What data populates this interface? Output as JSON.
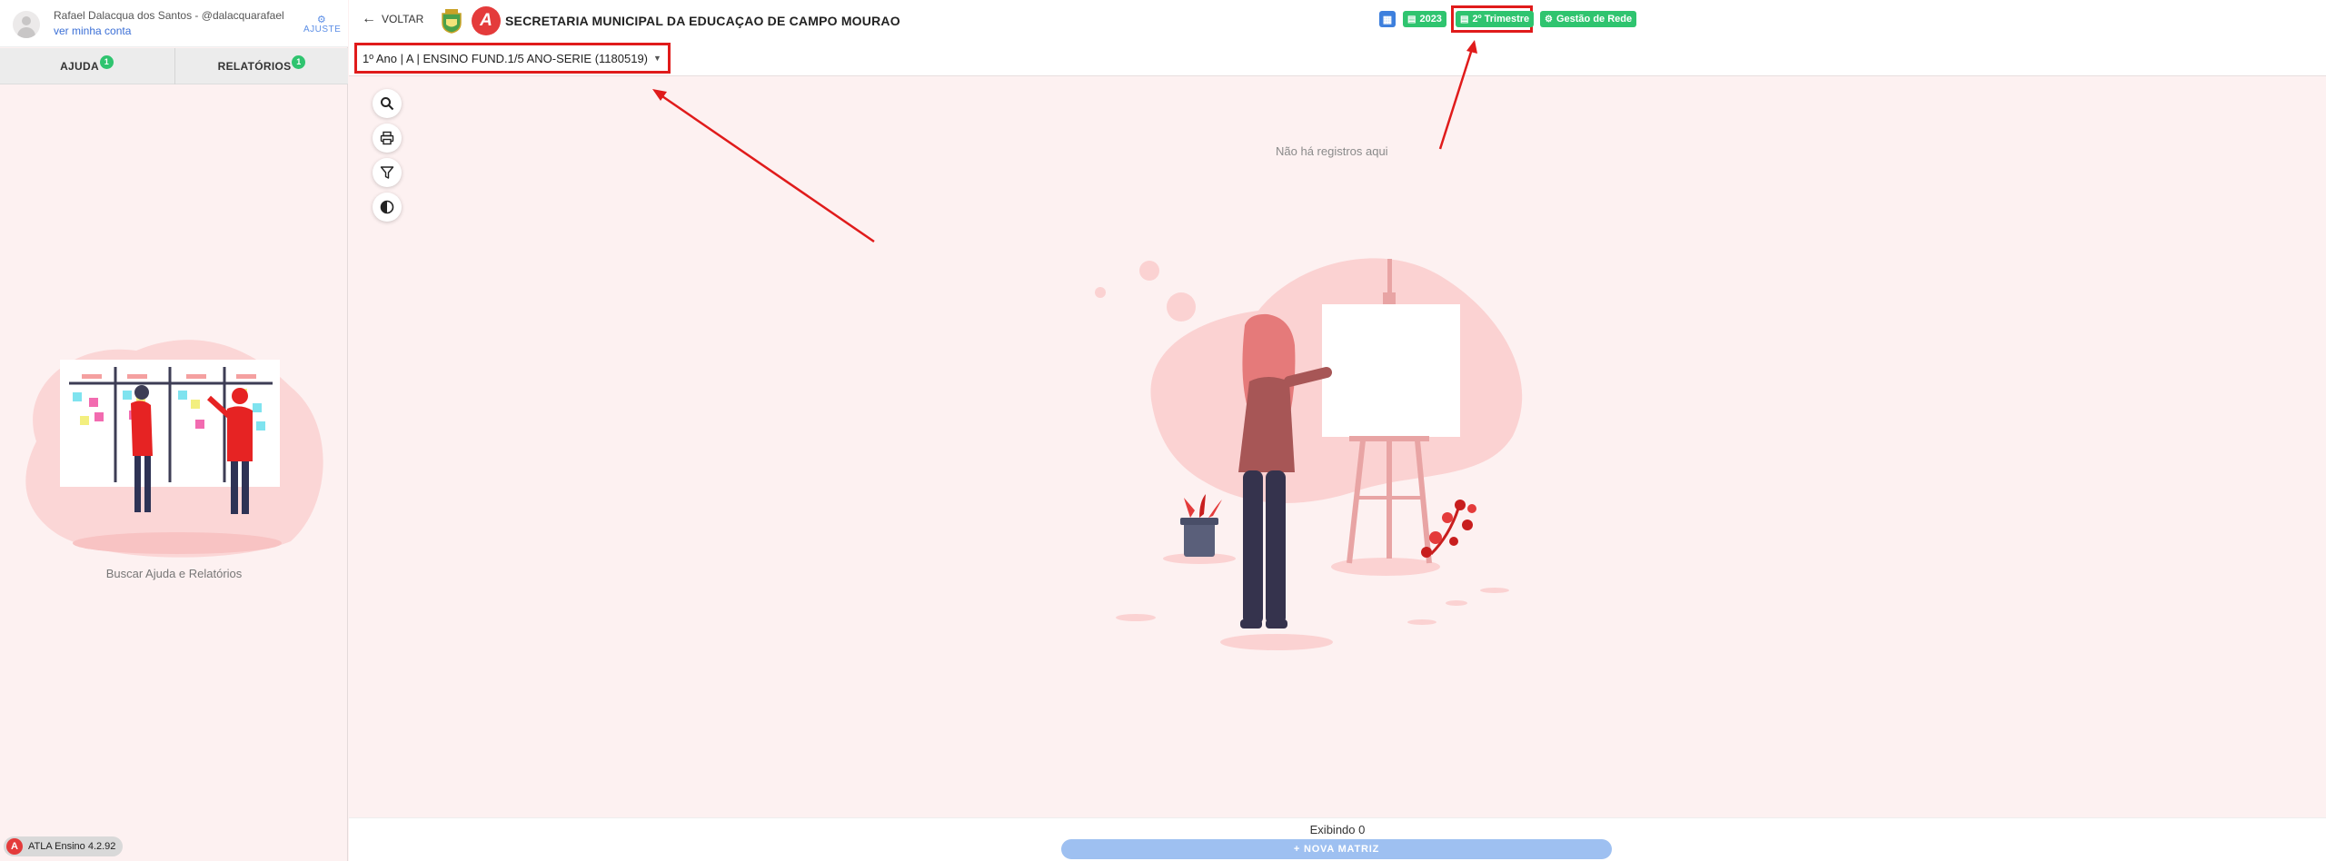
{
  "user": {
    "name": "Rafael Dalacqua dos Santos - @dalacquarafael",
    "account_link": "ver minha conta",
    "settings_label": "AJUSTE"
  },
  "sidebar": {
    "tabs": [
      {
        "label": "AJUDA",
        "badge": "1"
      },
      {
        "label": "RELATÓRIOS",
        "badge": "1"
      }
    ],
    "empty_caption": "Buscar Ajuda e Relatórios"
  },
  "app_version": "ATLA Ensino 4.2.92",
  "header": {
    "back_label": "VOLTAR",
    "title": "SECRETARIA MUNICIPAL DA EDUCAÇAO DE CAMPO MOURAO",
    "pills": {
      "year": "2023",
      "term": "2º Trimestre",
      "network": "Gestão de Rede"
    }
  },
  "class_select": {
    "value": "1º Ano | A | ENSINO FUND.1/5 ANO-SERIE (1180519)"
  },
  "tools": [
    {
      "icon": "search-icon"
    },
    {
      "icon": "print-icon"
    },
    {
      "icon": "filter-icon"
    },
    {
      "icon": "contrast-icon"
    }
  ],
  "main": {
    "empty_text": "Não há registros aqui"
  },
  "footer": {
    "count_label": "Exibindo 0",
    "new_button": "+ NOVA MATRIZ"
  },
  "colors": {
    "accent_green": "#2fc46f",
    "accent_blue": "#3d7fdd",
    "highlight_red": "#e01b1b",
    "brand_red": "#e43b3b",
    "background_pink": "#fdf1f1"
  }
}
